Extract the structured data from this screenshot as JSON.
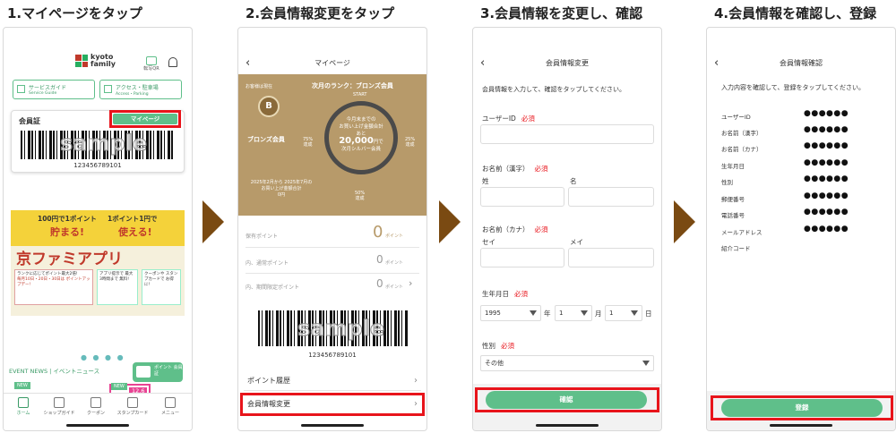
{
  "steps": [
    {
      "title": "1.マイページをタップ"
    },
    {
      "title": "2.会員情報変更をタップ"
    },
    {
      "title": "3.会員情報を変更し、確認"
    },
    {
      "title": "4.会員情報を確認し、登録"
    }
  ],
  "screen1": {
    "logo_line1": "kyoto",
    "logo_line2": "family",
    "member_qr": "転写QR",
    "service_guide": "サービスガイド",
    "service_guide_sub": "Service Guide",
    "access": "アクセス・駐車場",
    "access_sub": "Access・Parking",
    "card_label": "会員証",
    "mypage_button": "マイページ",
    "sample": "sample",
    "card_number": "123456789101",
    "banner_line1a": "100円で1ポイント",
    "banner_line1b": "1ポイント1円で",
    "banner_tamaru": "貯まる!",
    "banner_tsukaeru": "使える!",
    "banner_title": "京ファミアプリ",
    "banner_sub1": "ランクに応じてポイント最大2倍!",
    "banner_sub2": "毎月10日・20日・30日は ポイントアップデー!",
    "banner_sub3": "アプリ提示で 最大3時間まで 無料!",
    "banner_sub4": "クーポンや スタンプカードで お得に!",
    "event_news": "EVENT NEWS | イベントニュース",
    "point_card": "ポイント 会員証",
    "new1": "NEW",
    "new2": "NEW",
    "date_badge": "12.6",
    "tabs": [
      "ホーム",
      "ショップガイド",
      "クーポン",
      "スタンプカード",
      "メニュー"
    ]
  },
  "screen2": {
    "header": "マイページ",
    "current_label": "お客様は現在",
    "next_rank": "次月のランク：ブロンズ会員",
    "start": "START",
    "medal_letter": "B",
    "rank_name": "ブロンズ会員",
    "circle_line1": "今月末までの",
    "circle_line2": "お買い上げ金額合計",
    "circle_line3": "あと",
    "circle_amount": "20,000",
    "circle_yen": "円で",
    "circle_line4": "次月シルバー会員",
    "pct75": "75%",
    "pct75b": "達成",
    "pct25": "25%",
    "pct25b": "達成",
    "pct50": "50%",
    "pct50b": "達成",
    "period_line1": "2025年2月から 2025年7月の",
    "period_line2": "お買い上げ金額合計",
    "period_amount": "0円",
    "points_held": "保有ポイント",
    "points_held_value": "0",
    "points_unit": "ポイント",
    "normal_points": "内、通常ポイント",
    "normal_points_value": "0",
    "limited_points": "内、期間限定ポイント",
    "limited_points_value": "0",
    "sample": "sample",
    "card_number": "123456789101",
    "menu_history": "ポイント履歴",
    "menu_change": "会員情報変更"
  },
  "screen3": {
    "header": "会員情報変更",
    "intro": "会員情報を入力して、確認をタップしてください。",
    "required": "必須",
    "user_id_label": "ユーザーID",
    "name_kanji_label": "お名前（漢字）",
    "sei": "姓",
    "mei": "名",
    "name_kana_label": "お名前（カナ）",
    "sei_kana": "セイ",
    "mei_kana": "メイ",
    "birth_label": "生年月日",
    "birth_year": "1995",
    "year_unit": "年",
    "birth_month": "1",
    "month_unit": "月",
    "birth_day": "1",
    "day_unit": "日",
    "gender_label": "性別",
    "gender_value": "その他",
    "confirm_button": "確認"
  },
  "screen4": {
    "header": "会員情報確認",
    "intro": "入力内容を確認して、登録をタップしてください。",
    "rows": [
      {
        "label": "ユーザーID",
        "value": "●●●●●●"
      },
      {
        "label": "お名前（漢字）",
        "value": "●●●●●●"
      },
      {
        "label": "お名前（カナ）",
        "value": "●●●●●●"
      },
      {
        "label": "生年月日",
        "value": "●●●●●●"
      },
      {
        "label": "性別",
        "value": "●●●●●●"
      },
      {
        "label": "郵便番号",
        "value": "●●●●●●"
      },
      {
        "label": "電話番号",
        "value": "●●●●●●"
      },
      {
        "label": "メールアドレス",
        "value": "●●●●●●"
      },
      {
        "label": "紹介コード",
        "value": ""
      }
    ],
    "register_button": "登録"
  },
  "colors": {
    "accent_green": "#5fbf8a",
    "highlight_red": "#e8141b",
    "arrow_brown": "#7a4a12",
    "bronze_bg": "#b79a6a"
  }
}
